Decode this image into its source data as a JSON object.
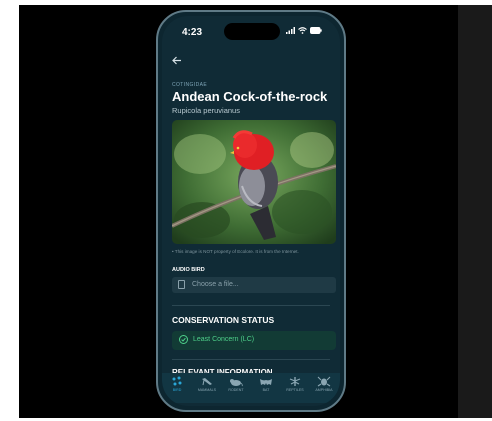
{
  "status_bar": {
    "time": "4:23",
    "icons": "signal wifi battery"
  },
  "species": {
    "family": "COTINGIDAE",
    "common_name": "Andean Cock-of-the-rock",
    "scientific_name": "Rupicola peruvianus"
  },
  "image_disclaimer": "• This image is NOT property of Ecolore. It is from the Internet.",
  "audio": {
    "label": "AUDIO BIRD",
    "placeholder": "Choose a file..."
  },
  "conservation": {
    "heading": "CONSERVATION STATUS",
    "status": "Least Concern (LC)",
    "status_color": "#4ed08a"
  },
  "relevant_heading": "RELEVANT INFORMATION",
  "nav": [
    {
      "label": "BIRD",
      "icon": "bird-icon",
      "active": true
    },
    {
      "label": "MAMMALS",
      "icon": "mammal-icon",
      "active": false
    },
    {
      "label": "RODENT",
      "icon": "rodent-icon",
      "active": false
    },
    {
      "label": "BAT",
      "icon": "bat-icon",
      "active": false
    },
    {
      "label": "REPTILES",
      "icon": "reptile-icon",
      "active": false
    },
    {
      "label": "AMPHIBIA",
      "icon": "amphibian-icon",
      "active": false
    }
  ],
  "colors": {
    "background": "#102b36",
    "accent": "#2aa7d8"
  }
}
